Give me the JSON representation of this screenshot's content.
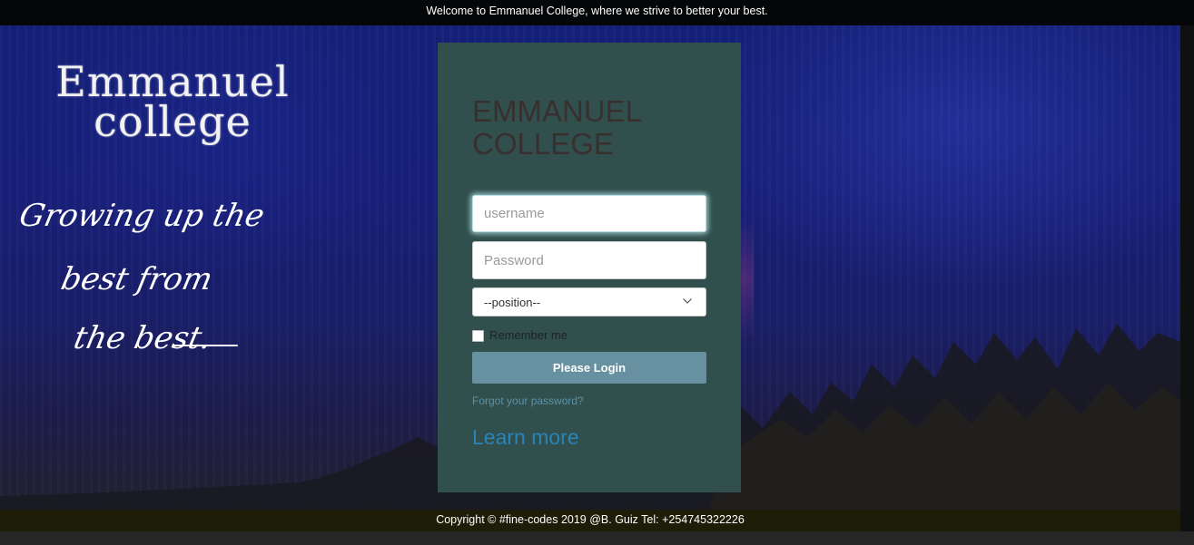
{
  "top_bar": {
    "welcome_text": "Welcome to Emmanuel College, where we strive to better your best."
  },
  "branding": {
    "logo_line1": "Emmanuel",
    "logo_line2": "college",
    "tagline_line1": "Growing up the",
    "tagline_line2": "best from",
    "tagline_line3": "the best."
  },
  "login": {
    "title": "EMMANUEL COLLEGE",
    "username_placeholder": "username",
    "username_value": "",
    "password_placeholder": "Password",
    "password_value": "",
    "position_selected": "--position--",
    "remember_label": "Remember me",
    "remember_checked": false,
    "submit_label": "Please Login",
    "forgot_link": "Forgot your password?",
    "learn_more_link": "Learn more"
  },
  "footer": {
    "copyright": "Copyright © #fine-codes 2019 @B. Guiz Tel: +254745322226"
  },
  "colors": {
    "panel": "#304f4d",
    "button": "#6791a0",
    "link": "#2a84b8",
    "hero_sky": "#15217a"
  }
}
